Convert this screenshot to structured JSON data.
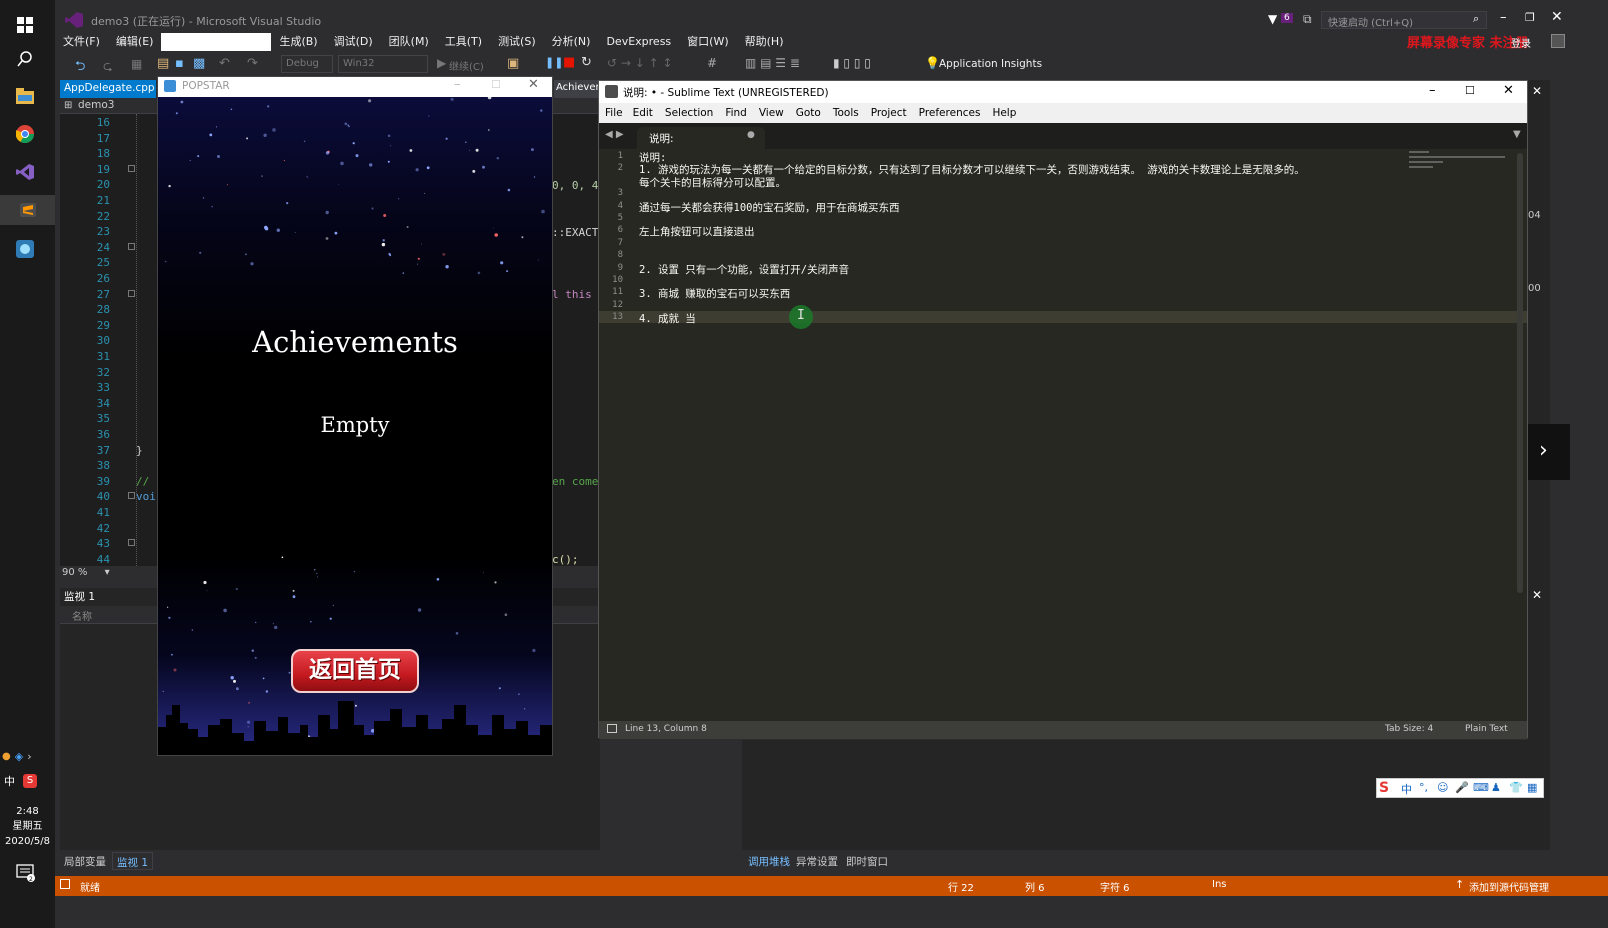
{
  "taskbar": {
    "time": "2:48",
    "weekday": "星期五",
    "date": "2020/5/8",
    "ime_label": "中",
    "icons": [
      "windows-start-icon",
      "search-icon",
      "file-explorer-icon",
      "chrome-icon",
      "visual-studio-icon",
      "sublime-icon",
      "app-icon",
      "notification-icon"
    ]
  },
  "vs": {
    "title": "demo3 (正在运行) - Microsoft Visual Studio",
    "notify_count": "6",
    "quick_launch_placeholder": "快速启动 (Ctrl+Q)",
    "watermark": "屏幕录像专家 未注册",
    "signin": "登录",
    "menu": [
      "文件(F)",
      "编辑(E)",
      "生成(B)",
      "调试(D)",
      "团队(M)",
      "工具(T)",
      "测试(S)",
      "分析(N)",
      "DevExpress",
      "窗口(W)",
      "帮助(H)"
    ],
    "toolbar": {
      "config": "Debug",
      "platform": "Win32",
      "continue_label": "继续(C)",
      "app_insights": "Application Insights"
    },
    "tabs": {
      "active": "AppDelegate.cpp",
      "second": "Achievem"
    },
    "project_dropdown": "demo3",
    "line_numbers": [
      "16",
      "17",
      "18",
      "19",
      "20",
      "21",
      "22",
      "23",
      "24",
      "25",
      "26",
      "27",
      "28",
      "29",
      "30",
      "31",
      "32",
      "33",
      "34",
      "35",
      "36",
      "37",
      "38",
      "39",
      "40",
      "41",
      "42",
      "43",
      "44"
    ],
    "code_fragments": {
      "l20": "0, 0, 4",
      "l23": "::EXACT",
      "l27": "l this",
      "l37": "}",
      "l39_comment": "//",
      "l39_tail": "en come",
      "l40": "voi",
      "l44": "c();"
    },
    "zoom": "90 %",
    "watch_title": "监视 1",
    "watch_col_name": "名称",
    "bottom_tabs_left": [
      "局部变量",
      "监视 1"
    ],
    "bottom_tabs_right": [
      "调用堆栈",
      "异常设置",
      "即时窗口"
    ],
    "right_edge_text": [
      "04",
      "00"
    ],
    "status": {
      "ready": "就绪",
      "row": "行 22",
      "col": "列 6",
      "char": "字符 6",
      "ins": "Ins",
      "source_control": "添加到源代码管理"
    }
  },
  "popstar": {
    "title": "POPSTAR",
    "heading": "Achievements",
    "content": "Empty",
    "back_button": "返回首页"
  },
  "sublime": {
    "title": "说明: • - Sublime Text (UNREGISTERED)",
    "menu": [
      "File",
      "Edit",
      "Selection",
      "Find",
      "View",
      "Goto",
      "Tools",
      "Project",
      "Preferences",
      "Help"
    ],
    "tab": "说明:",
    "lines": [
      {
        "n": "1",
        "t": "说明:"
      },
      {
        "n": "2",
        "t": "1.  游戏的玩法为每一关都有一个给定的目标分数，只有达到了目标分数才可以继续下一关，否则游戏结束。 游戏的关卡数理论上是无限多的。"
      },
      {
        "n": "",
        "t": "每个关卡的目标得分可以配置。"
      },
      {
        "n": "3",
        "t": ""
      },
      {
        "n": "4",
        "t": "通过每一关都会获得100的宝石奖励，用于在商城买东西"
      },
      {
        "n": "5",
        "t": ""
      },
      {
        "n": "6",
        "t": "左上角按钮可以直接退出"
      },
      {
        "n": "7",
        "t": ""
      },
      {
        "n": "8",
        "t": ""
      },
      {
        "n": "9",
        "t": "2. 设置  只有一个功能，设置打开/关闭声音"
      },
      {
        "n": "10",
        "t": ""
      },
      {
        "n": "11",
        "t": "3. 商城 赚取的宝石可以买东西"
      },
      {
        "n": "12",
        "t": ""
      },
      {
        "n": "13",
        "t": "4. 成就 当"
      }
    ],
    "status_position": "Line 13, Column 8",
    "tab_size": "Tab Size: 4",
    "syntax": "Plain Text"
  },
  "ime": {
    "label": "中"
  },
  "colors": {
    "vs_bg": "#2d2d30",
    "editor_bg": "#1e1e1e",
    "status_orange": "#ca5100",
    "sublime_bg": "#272822",
    "accent_blue": "#007acc",
    "button_red": "#c4191f"
  }
}
